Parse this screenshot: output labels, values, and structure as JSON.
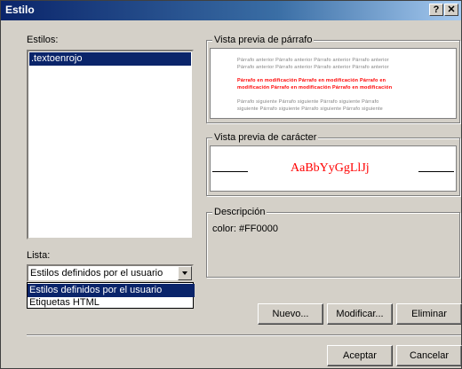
{
  "window": {
    "title": "Estilo",
    "help_label": "?",
    "close_label": "✕"
  },
  "styles": {
    "label": "Estilos:",
    "items": [
      ".textoenrojo"
    ]
  },
  "list": {
    "label": "Lista:",
    "selected": "Estilos definidos por el usuario",
    "options": [
      "Estilos definidos por el usuario",
      "Etiquetas HTML"
    ]
  },
  "paragraph_preview": {
    "title": "Vista previa de párrafo",
    "prev_line_1": "Párrafo anterior Párrafo anterior Párrafo anterior Párrafo anterior",
    "prev_line_2": "Párrafo anterior Párrafo anterior Párrafo anterior Párrafo anterior",
    "mod_line_1": "Párrafo en modificación Párrafo en modificación Párrafo en",
    "mod_line_2": "modificación Párrafo en modificación Párrafo en modificación",
    "next_line_1": "Párrafo siguiente Párrafo siguiente Párrafo siguiente Párrafo",
    "next_line_2": "siguiente Párrafo siguiente Párrafo siguiente Párrafo siguiente"
  },
  "char_preview": {
    "title": "Vista previa de carácter",
    "sample": "AaBbYyGgLlJj"
  },
  "description": {
    "title": "Descripción",
    "text": "color: #FF0000"
  },
  "buttons": {
    "new": "Nuevo...",
    "modify": "Modificar...",
    "delete": "Eliminar",
    "accept": "Aceptar",
    "cancel": "Cancelar"
  },
  "colors": {
    "title_bar": "#0a246a",
    "selection": "#0a246a",
    "sample_text": "#ff0000",
    "face": "#d4d0c8"
  }
}
